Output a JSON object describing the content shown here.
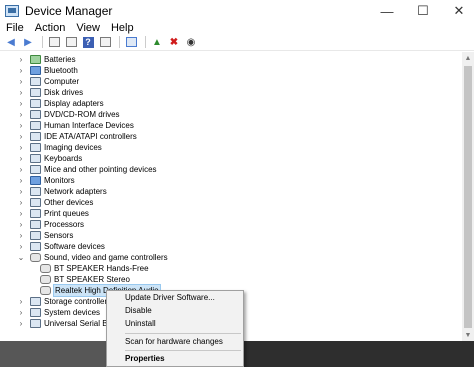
{
  "window": {
    "title": "Device Manager"
  },
  "titlebar_buttons": {
    "minimize": "—",
    "maximize": "☐",
    "close": "✕"
  },
  "menu": [
    "File",
    "Action",
    "View",
    "Help"
  ],
  "toolbar": {
    "help": "?"
  },
  "tree": {
    "categories": [
      "Batteries",
      "Bluetooth",
      "Computer",
      "Disk drives",
      "Display adapters",
      "DVD/CD-ROM drives",
      "Human Interface Devices",
      "IDE ATA/ATAPI controllers",
      "Imaging devices",
      "Keyboards",
      "Mice and other pointing devices",
      "Monitors",
      "Network adapters",
      "Other devices",
      "Print queues",
      "Processors",
      "Sensors",
      "Software devices",
      "Sound, video and game controllers"
    ],
    "sound_children": [
      "BT SPEAKER Hands-Free",
      "BT SPEAKER Stereo",
      "Realtek High Definition Audio"
    ],
    "after": [
      "Storage controllers",
      "System devices",
      "Universal Serial Bus co"
    ]
  },
  "context_menu": {
    "update": "Update Driver Software...",
    "disable": "Disable",
    "uninstall": "Uninstall",
    "scan": "Scan for hardware changes",
    "properties": "Properties"
  }
}
